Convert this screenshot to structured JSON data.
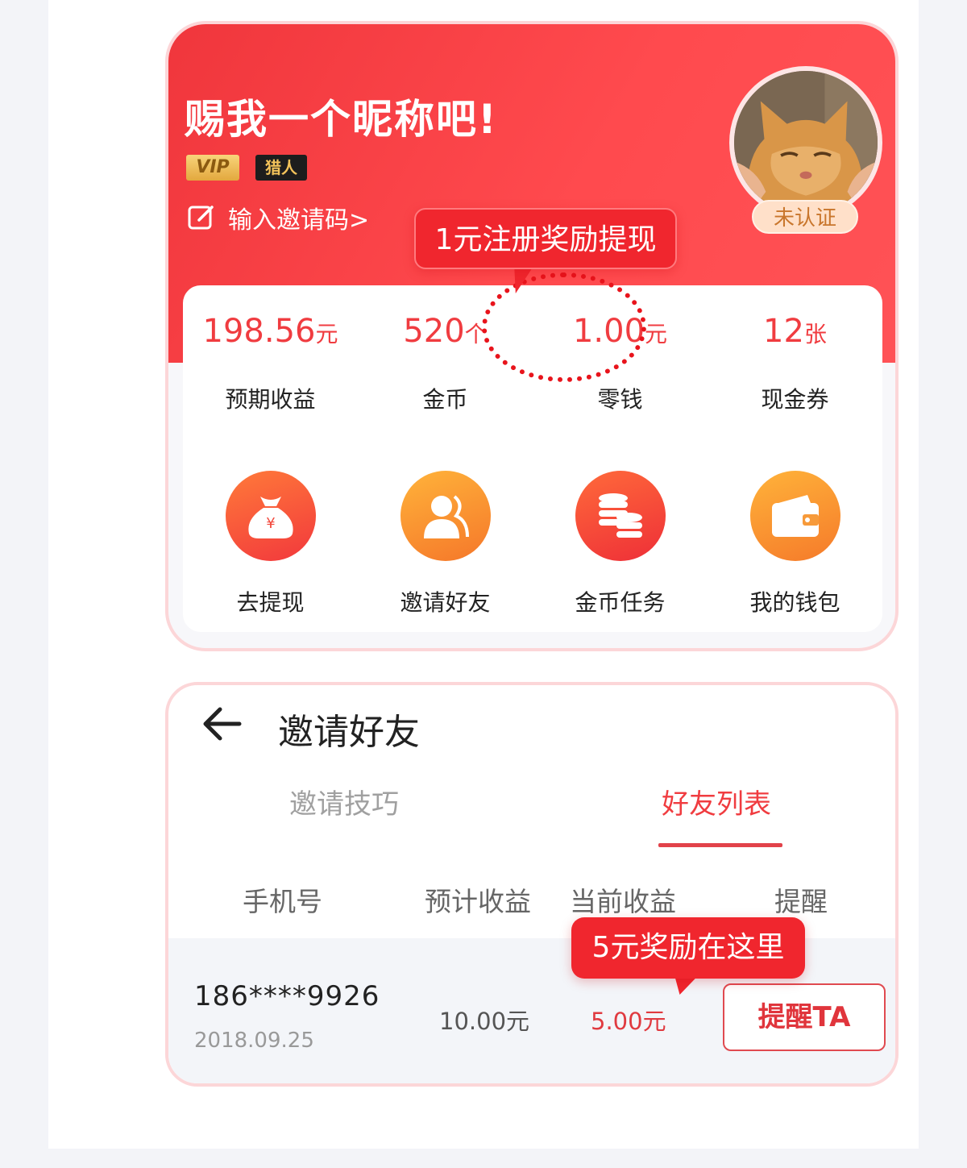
{
  "profile": {
    "nickname": "赐我一个昵称吧!",
    "vip_badge": "VIP",
    "role_badge": "猎人",
    "invite_code_link": "输入邀请码>",
    "verify_status": "未认证",
    "avatar_icon": "cat-avatar-icon"
  },
  "callouts": {
    "register_reward": "1元注册奖励提现",
    "reward_here": "5元奖励在这里"
  },
  "stats": [
    {
      "value": "198.56",
      "unit": "元",
      "label": "预期收益"
    },
    {
      "value": "520",
      "unit": "个",
      "label": "金币"
    },
    {
      "value": "1.00",
      "unit": "元",
      "label": "零钱"
    },
    {
      "value": "12",
      "unit": "张",
      "label": "现金券"
    }
  ],
  "actions": [
    {
      "label": "去提现",
      "icon": "money-bag-icon",
      "color_from": "#ff7a3a",
      "color_to": "#f2383c"
    },
    {
      "label": "邀请好友",
      "icon": "users-icon",
      "color_from": "#ffb33a",
      "color_to": "#f5772a"
    },
    {
      "label": "金币任务",
      "icon": "coins-icon",
      "color_from": "#ff6a3a",
      "color_to": "#ee2f38"
    },
    {
      "label": "我的钱包",
      "icon": "wallet-icon",
      "color_from": "#ffb33a",
      "color_to": "#f57a2a"
    }
  ],
  "invite": {
    "title": "邀请好友",
    "tabs": [
      "邀请技巧",
      "好友列表"
    ],
    "active_tab": "好友列表",
    "columns": [
      "手机号",
      "预计收益",
      "当前收益",
      "提醒"
    ],
    "rows": [
      {
        "phone": "186****9926",
        "date": "2018.09.25",
        "expected": "10.00元",
        "current": "5.00元",
        "action": "提醒TA"
      }
    ]
  },
  "colors": {
    "brand_red": "#f03c40",
    "callout_red": "#f0262e",
    "card_border": "#fcd6d8"
  }
}
